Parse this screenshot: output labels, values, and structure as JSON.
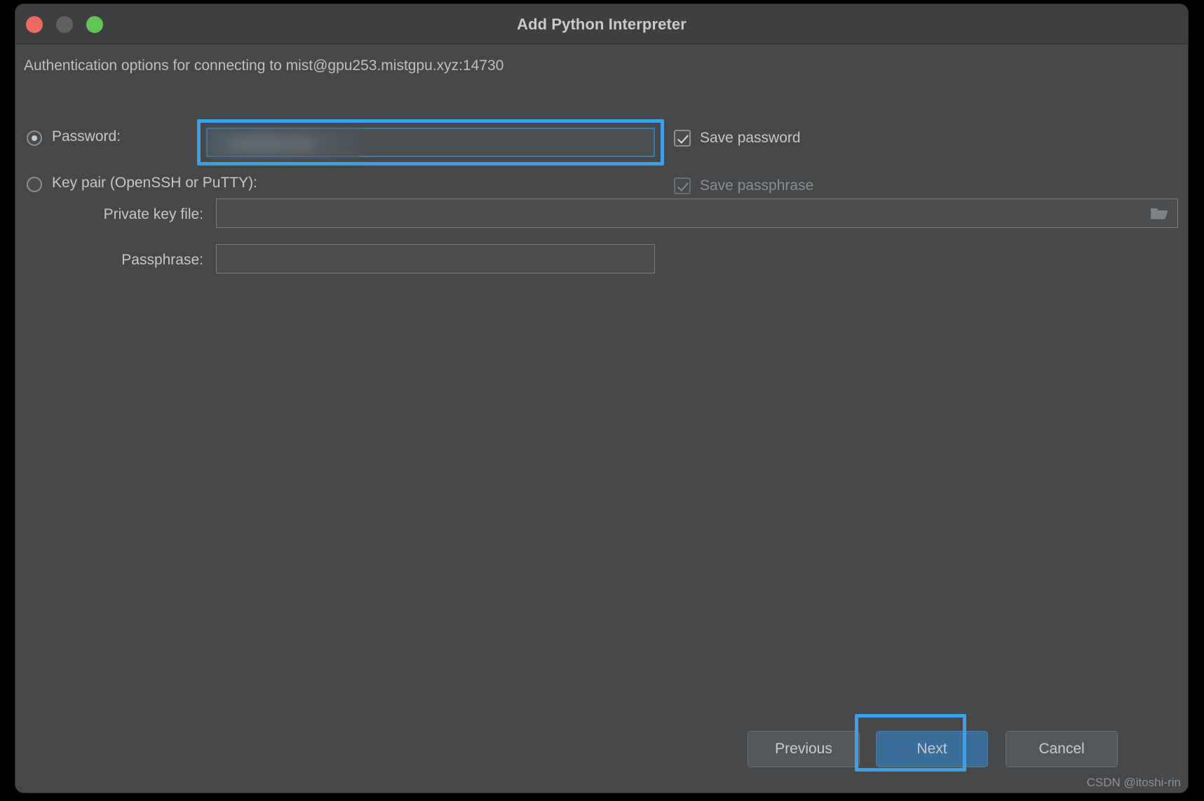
{
  "window": {
    "title": "Add Python Interpreter",
    "traffic_lights": [
      {
        "name": "close",
        "color": "#ec6a5f"
      },
      {
        "name": "minimize",
        "color": "#5e6062"
      },
      {
        "name": "zoom",
        "color": "#61c555"
      }
    ]
  },
  "content": {
    "description": "Authentication options for connecting to mist@gpu253.mistgpu.xyz:14730",
    "auth_mode_selected": "password",
    "password_option": {
      "label": "Password:",
      "value": "",
      "redacted": true
    },
    "save_password": {
      "label": "Save password",
      "checked": true,
      "enabled": true
    },
    "keypair_option": {
      "label": "Key pair (OpenSSH or PuTTY):"
    },
    "private_key_file": {
      "label": "Private key file:",
      "value": "",
      "browse_icon": "folder-icon"
    },
    "passphrase": {
      "label": "Passphrase:",
      "value": ""
    },
    "save_passphrase": {
      "label": "Save passphrase",
      "checked": true,
      "enabled": false
    }
  },
  "footer": {
    "previous_label": "Previous",
    "next_label": "Next",
    "cancel_label": "Cancel",
    "default_button": "Next"
  },
  "annotations": {
    "highlight_color": "#3aa0e8",
    "targets": [
      "password-field",
      "next-button"
    ]
  },
  "watermark": "CSDN @itoshi-rin"
}
